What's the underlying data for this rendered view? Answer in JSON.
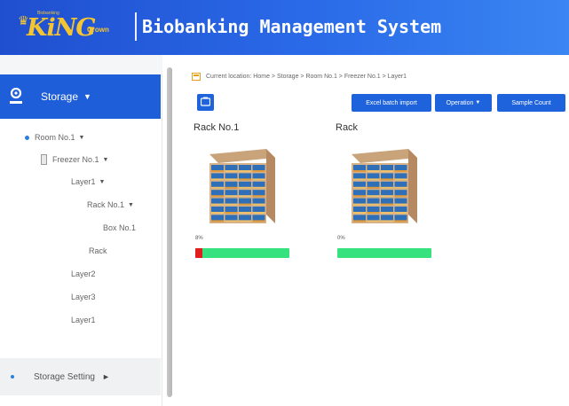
{
  "header": {
    "logo_main": "KiNG",
    "logo_sub": "Crown",
    "logo_tiny": "Biobanking",
    "title": "Biobanking Management System"
  },
  "sidebar": {
    "storage_label": "Storage",
    "tree": {
      "room": "Room No.1",
      "freezer": "Freezer No.1",
      "layer1": "Layer1",
      "rack": "Rack No.1",
      "box": "Box No.1",
      "rack2": "Rack",
      "layer2": "Layer2",
      "layer3": "Layer3",
      "layer4": "Layer1"
    },
    "setting_label": "Storage Setting"
  },
  "main": {
    "breadcrumb": "Current location: Home > Storage > Room No.1 > Freezer No.1 > Layer1",
    "buttons": {
      "batch_import": "Excel batch import",
      "operation": "Operation",
      "sample_count": "Sample Count"
    },
    "racks": [
      {
        "name": "Rack No.1",
        "percent_label": "8%",
        "usage": 0.08
      },
      {
        "name": "Rack",
        "percent_label": "0%",
        "usage": 0.0
      }
    ]
  },
  "colors": {
    "header_blue": "#2a6ae8",
    "accent_blue": "#1f5ed9",
    "logo_gold": "#f4c531",
    "usage_green": "#35e27e",
    "usage_red": "#e21d1d"
  }
}
